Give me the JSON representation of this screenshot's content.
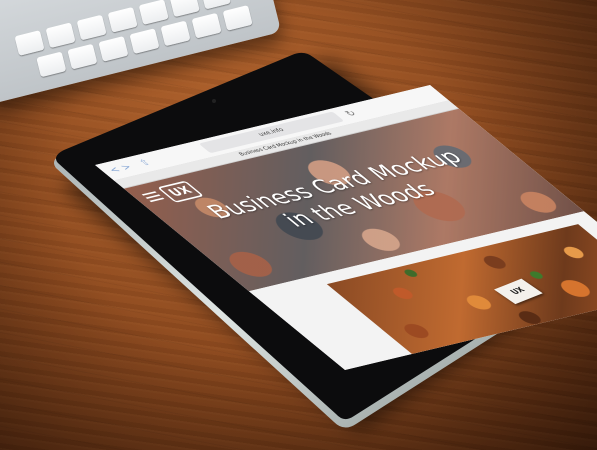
{
  "browser": {
    "back": "<",
    "forward": ">",
    "share": "⇧",
    "url": "uxe.info",
    "reload": "↻",
    "tab_title": "Business Card Mockup in the Woods"
  },
  "site": {
    "logo": "UX",
    "hero_title": "Business Card Mockup in the Woods",
    "card_text": "UX"
  }
}
